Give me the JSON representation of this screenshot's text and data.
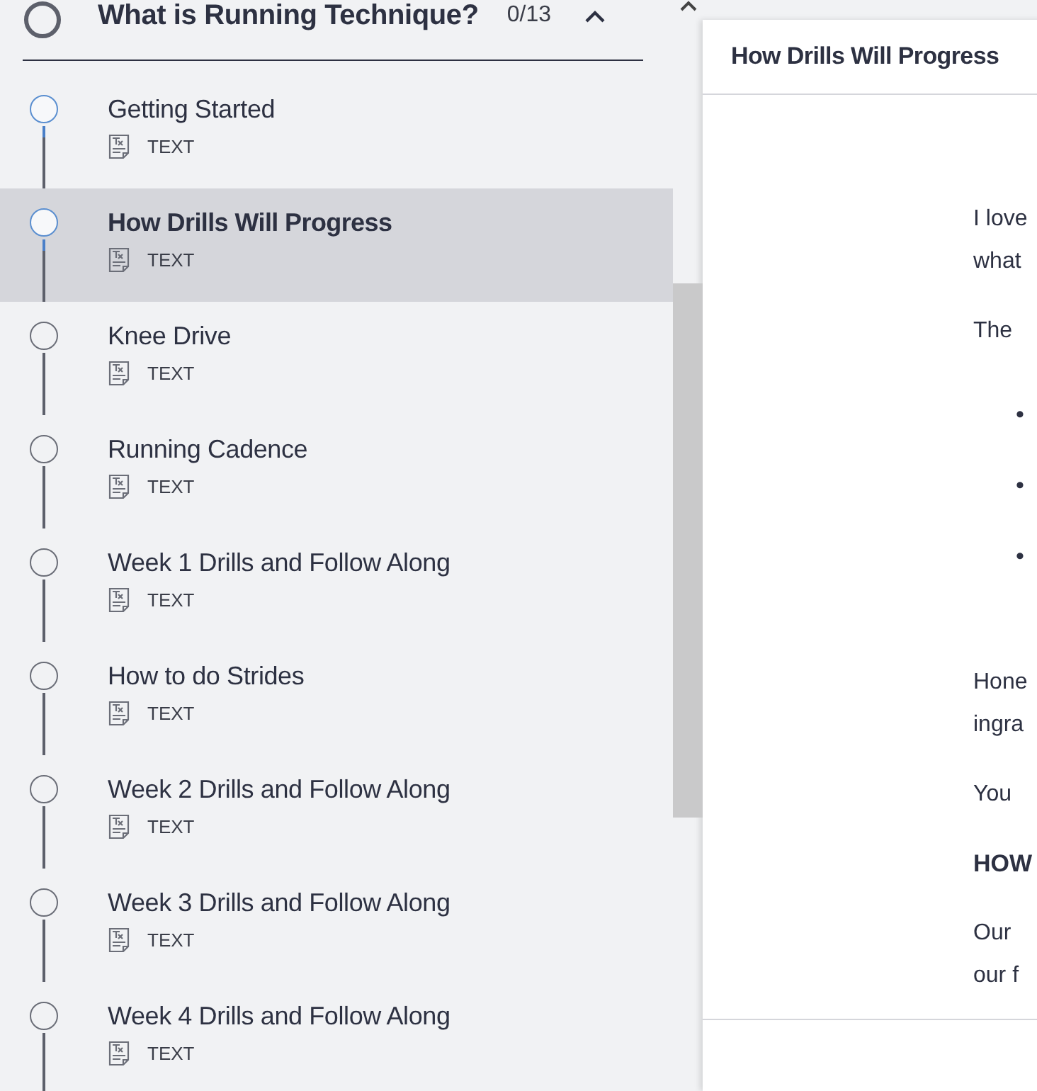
{
  "section": {
    "title": "What is Running Technique?",
    "progress": "0/13",
    "expanded": true
  },
  "lessons": [
    {
      "title": "Getting Started",
      "type": "TEXT",
      "selected": false,
      "visited": true
    },
    {
      "title": "How Drills Will Progress",
      "type": "TEXT",
      "selected": true,
      "visited": true
    },
    {
      "title": "Knee Drive",
      "type": "TEXT",
      "selected": false,
      "visited": false
    },
    {
      "title": "Running Cadence",
      "type": "TEXT",
      "selected": false,
      "visited": false
    },
    {
      "title": "Week 1 Drills and Follow Along",
      "type": "TEXT",
      "selected": false,
      "visited": false
    },
    {
      "title": "How to do Strides",
      "type": "TEXT",
      "selected": false,
      "visited": false
    },
    {
      "title": "Week 2 Drills and Follow Along",
      "type": "TEXT",
      "selected": false,
      "visited": false
    },
    {
      "title": "Week 3 Drills and Follow Along",
      "type": "TEXT",
      "selected": false,
      "visited": false
    },
    {
      "title": "Week 4 Drills and Follow Along",
      "type": "TEXT",
      "selected": false,
      "visited": false
    }
  ],
  "panel": {
    "title": "How Drills Will Progress",
    "blocks": [
      {
        "kind": "para",
        "lines": [
          "I love",
          "what"
        ]
      },
      {
        "kind": "para",
        "lines": [
          "The"
        ]
      },
      {
        "kind": "bullets",
        "items": [
          "•",
          "•",
          "•"
        ]
      },
      {
        "kind": "para",
        "lines": [
          "Hone",
          "ingra"
        ]
      },
      {
        "kind": "para",
        "lines": [
          "You"
        ]
      },
      {
        "kind": "heading",
        "lines": [
          "HOW"
        ]
      },
      {
        "kind": "para",
        "lines": [
          "Our",
          "our f"
        ]
      }
    ]
  }
}
